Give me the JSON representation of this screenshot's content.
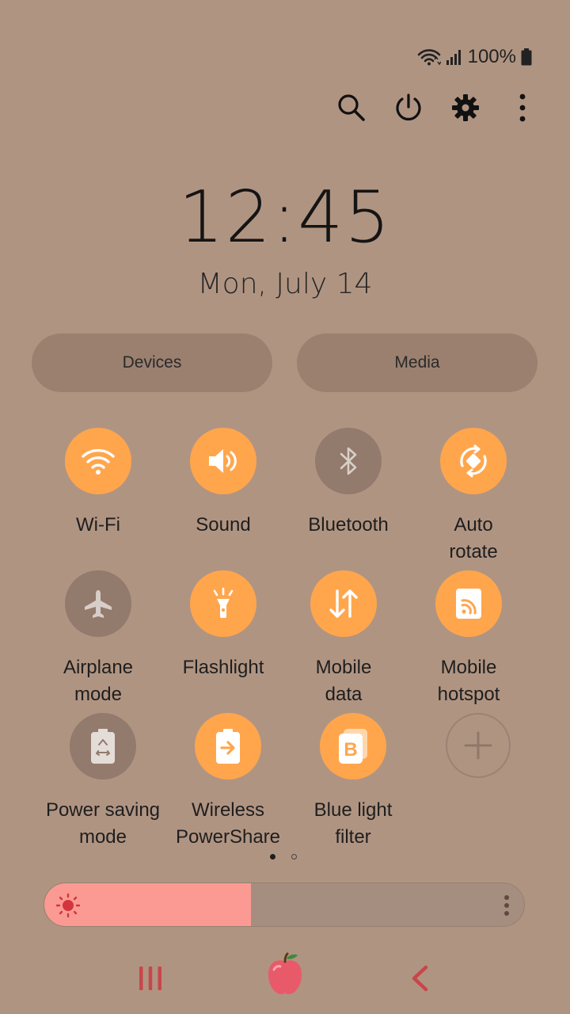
{
  "status": {
    "battery_text": "100%",
    "icons": [
      "wifi-icon",
      "signal-icon",
      "battery-icon"
    ]
  },
  "top_actions": [
    "search-icon",
    "power-icon",
    "gear-icon",
    "more-vert-icon"
  ],
  "clock": {
    "time": "12:45",
    "date": "Mon, July 14"
  },
  "pills": {
    "devices": "Devices",
    "media": "Media"
  },
  "tiles": [
    {
      "label": "Wi-Fi",
      "icon": "wifi-icon",
      "state": "on"
    },
    {
      "label": "Sound",
      "icon": "speaker-icon",
      "state": "on"
    },
    {
      "label": "Bluetooth",
      "icon": "bluetooth-icon",
      "state": "off"
    },
    {
      "label": "Auto\nrotate",
      "icon": "auto-rotate-icon",
      "state": "on"
    },
    {
      "label": "Airplane\nmode",
      "icon": "airplane-icon",
      "state": "off"
    },
    {
      "label": "Flashlight",
      "icon": "flashlight-icon",
      "state": "on"
    },
    {
      "label": "Mobile\ndata",
      "icon": "mobile-data-icon",
      "state": "on"
    },
    {
      "label": "Mobile\nhotspot",
      "icon": "hotspot-icon",
      "state": "on"
    },
    {
      "label": "Power saving\nmode",
      "icon": "power-saving-icon",
      "state": "off"
    },
    {
      "label": "Wireless\nPowerShare",
      "icon": "wireless-powershare-icon",
      "state": "on"
    },
    {
      "label": "Blue light\nfilter",
      "icon": "blue-light-filter-icon",
      "state": "on"
    },
    {
      "label": "",
      "icon": "add-icon",
      "state": "add"
    }
  ],
  "pager": {
    "pages": 2,
    "current": 1
  },
  "brightness": {
    "level": 0.43
  },
  "colors": {
    "background": "#b09482",
    "tile_on": "#ffa64d",
    "tile_off": "#927a6d",
    "brightness_fill": "#fb9a92",
    "nav_accent": "#c8464b"
  },
  "navbar": [
    "recents-icon",
    "home-apple-icon",
    "back-icon"
  ]
}
